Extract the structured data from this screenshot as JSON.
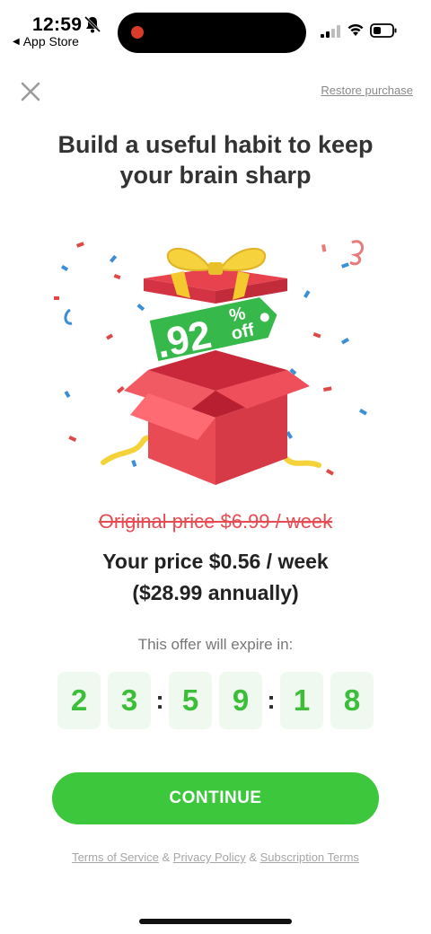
{
  "status_bar": {
    "time": "12:59",
    "back_label": "App Store"
  },
  "header": {
    "restore_label": "Restore purchase"
  },
  "title": {
    "line1": "Build a useful habit to keep",
    "line2": "your brain sharp"
  },
  "badge": {
    "percent": ".92",
    "percent_sign": "%",
    "off": "off"
  },
  "pricing": {
    "original": "Original price $6.99 / week",
    "yours": "Your price $0.56 / week",
    "annual": "($28.99 annually)"
  },
  "countdown": {
    "label": "This offer will expire in:",
    "digits": [
      "2",
      "3",
      "5",
      "9",
      "1",
      "8"
    ],
    "separator": ":"
  },
  "cta": {
    "continue_label": "CONTINUE"
  },
  "legal": {
    "terms": "Terms of Service",
    "amp1": " & ",
    "privacy": "Privacy Policy",
    "amp2": " & ",
    "subscription": "Subscription Terms"
  },
  "colors": {
    "accent_green": "#3dc73d",
    "strike_red": "#e74c52",
    "digit_bg": "#f0f9ef"
  }
}
